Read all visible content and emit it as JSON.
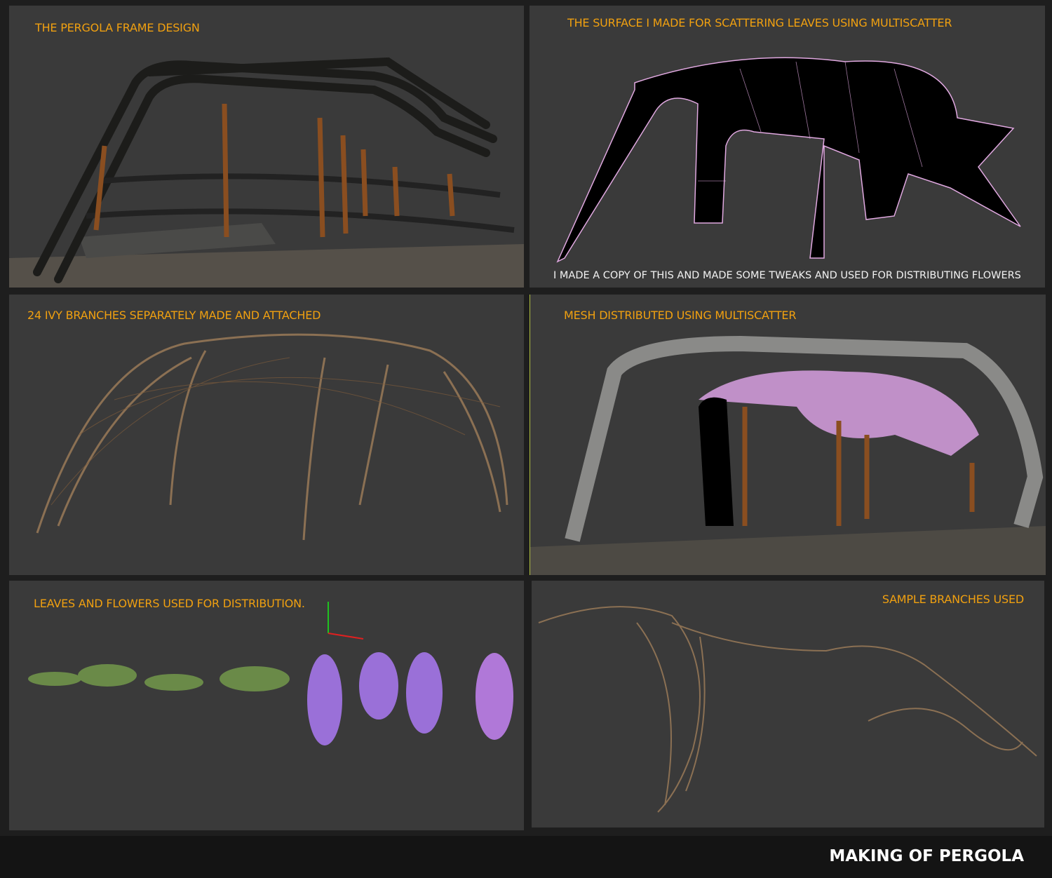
{
  "panels": [
    {
      "caption": "THE PERGOLA FRAME DESIGN"
    },
    {
      "caption": "THE SURFACE I MADE FOR SCATTERING LEAVES USING MULTISCATTER",
      "note": "I MADE A COPY OF THIS AND MADE SOME TWEAKS AND USED FOR DISTRIBUTING FLOWERS"
    },
    {
      "caption": "24 IVY BRANCHES SEPARATELY MADE AND ATTACHED"
    },
    {
      "caption": "MESH DISTRIBUTED USING MULTISCATTER"
    },
    {
      "caption": "LEAVES AND FLOWERS USED FOR DISTRIBUTION."
    },
    {
      "caption": "SAMPLE BRANCHES USED"
    }
  ],
  "footer": {
    "title": "MAKING OF PERGOLA"
  },
  "colors": {
    "caption": "#f0a010",
    "panel": "#3a3a3a",
    "background": "#1e1e1e",
    "wire": "#e0a8e0",
    "branch": "#9a7a58",
    "flower": "#9a70d8",
    "leaf": "#6a8a48"
  }
}
